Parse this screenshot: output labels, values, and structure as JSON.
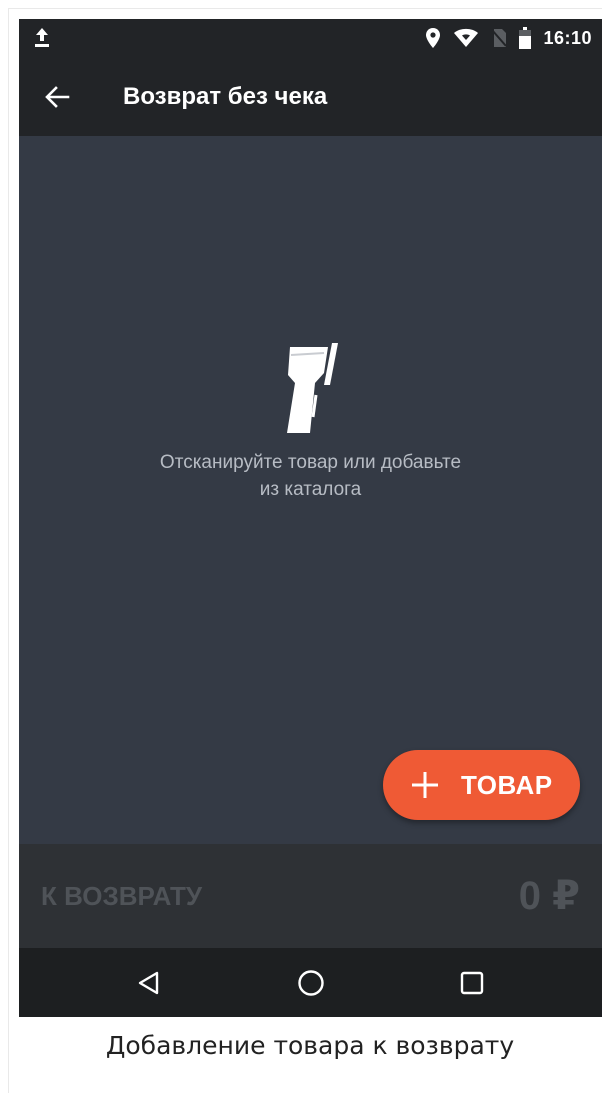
{
  "status_bar": {
    "time": "16:10",
    "icons": [
      "upload-icon",
      "location-icon",
      "wifi-icon",
      "no-sim-icon",
      "battery-icon"
    ]
  },
  "app_bar": {
    "back_icon": "arrow-left-icon",
    "title": "Возврат без чека"
  },
  "empty_state": {
    "icon": "barcode-scanner-icon",
    "line1": "Отсканируйте товар или добавьте",
    "line2": "из каталога"
  },
  "fab": {
    "icon": "plus-icon",
    "label": "ТОВАР",
    "color": "#ef5a35"
  },
  "summary": {
    "label": "К ВОЗВРАТУ",
    "value": "0 ₽"
  },
  "nav_bar": {
    "back_icon": "triangle-back-icon",
    "home_icon": "circle-home-icon",
    "recents_icon": "square-recents-icon"
  },
  "caption": "Добавление товара к возврату",
  "colors": {
    "background": "#343a45",
    "toolbar": "#222427",
    "accent": "#ef5a35"
  }
}
